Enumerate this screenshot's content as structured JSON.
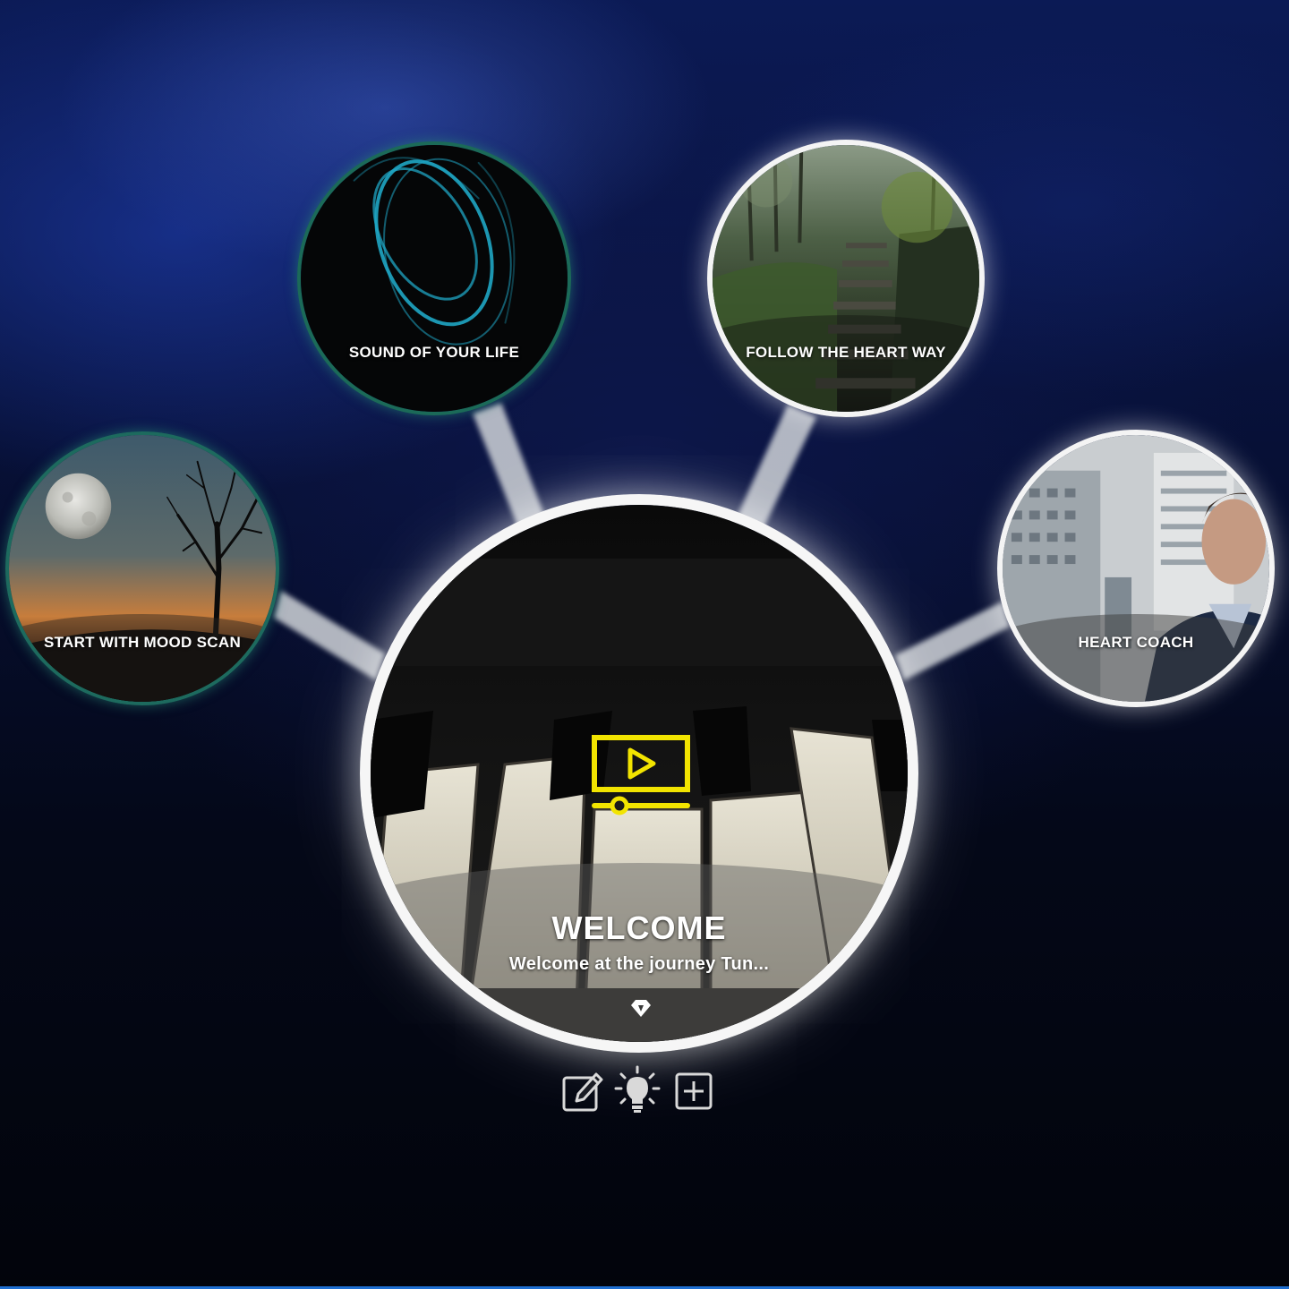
{
  "nodes": {
    "center": {
      "title": "WELCOME",
      "subtitle": "Welcome at the journey Tun...",
      "icon": "video-play-icon",
      "badge_icon": "diamond-icon",
      "accent": "#f2e400"
    },
    "mood_scan": {
      "label": "START WITH MOOD SCAN",
      "border_color": "#1d6a5e"
    },
    "sound": {
      "label": "SOUND OF YOUR LIFE",
      "border_color": "#1b6a58"
    },
    "follow": {
      "label": "FOLLOW THE HEART WAY",
      "border_color": "#f4f4f4"
    },
    "coach": {
      "label": "HEART COACH",
      "border_color": "#f4f4f4"
    }
  },
  "toolbar": {
    "edit_icon": "pencil-edit-icon",
    "idea_icon": "lightbulb-icon",
    "add_icon": "plus-square-icon"
  }
}
